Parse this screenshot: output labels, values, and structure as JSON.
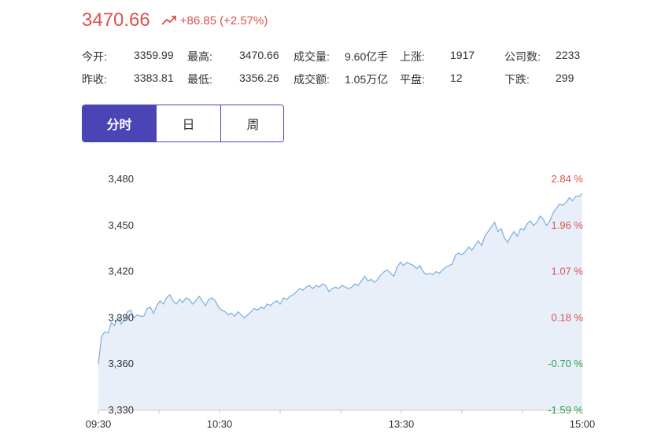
{
  "quote": {
    "price": "3470.66",
    "change": "+86.85",
    "change_pct": "(+2.57%)",
    "up_color": "#d9534f",
    "down_color": "#2e9e4f",
    "trend_icon": "trend-up-icon"
  },
  "stats": {
    "row1": [
      {
        "label": "今开:",
        "value": "3359.99"
      },
      {
        "label": "最高:",
        "value": "3470.66"
      },
      {
        "label": "成交量:",
        "value": "9.60亿手"
      },
      {
        "label": "上涨:",
        "value": "1917"
      },
      {
        "label": "公司数:",
        "value": "2233"
      }
    ],
    "row2": [
      {
        "label": "昨收:",
        "value": "3383.81"
      },
      {
        "label": "最低:",
        "value": "3356.26"
      },
      {
        "label": "成交额:",
        "value": "1.05万亿"
      },
      {
        "label": "平盘:",
        "value": "12"
      },
      {
        "label": "下跌:",
        "value": "299"
      }
    ]
  },
  "tabs": [
    {
      "label": "分时",
      "active": true
    },
    {
      "label": "日",
      "active": false
    },
    {
      "label": "周",
      "active": false
    }
  ],
  "accent_color": "#4a44b4",
  "chart_data": {
    "type": "area",
    "title": "",
    "xlabel": "",
    "ylabel": "",
    "x_ticks": [
      "09:30",
      "10:30",
      "13:30",
      "15:00"
    ],
    "y_ticks": [
      3330,
      3360,
      3390,
      3420,
      3450,
      3480
    ],
    "y_tick_labels": [
      "3,330",
      "3,360",
      "3,390",
      "3,420",
      "3,450",
      "3,480"
    ],
    "pct_ticks": [
      "-1.59 %",
      "-0.70 %",
      "0.18 %",
      "1.07 %",
      "1.96 %",
      "2.84 %"
    ],
    "ylim": [
      3330,
      3480
    ],
    "grid": false,
    "line_color": "#7aaee0",
    "fill_color": "#e8eff9",
    "series": [
      {
        "values": [
          3360,
          3378,
          3381,
          3380,
          3387,
          3385,
          3391,
          3386,
          3389,
          3394,
          3395,
          3390,
          3392,
          3391,
          3391,
          3396,
          3397,
          3393,
          3398,
          3401,
          3399,
          3403,
          3405,
          3401,
          3399,
          3402,
          3400,
          3403,
          3402,
          3399,
          3401,
          3404,
          3401,
          3398,
          3402,
          3403,
          3401,
          3397,
          3395,
          3394,
          3392,
          3393,
          3391,
          3394,
          3392,
          3390,
          3392,
          3394,
          3396,
          3395,
          3397,
          3396,
          3399,
          3398,
          3400,
          3401,
          3399,
          3403,
          3402,
          3404,
          3405,
          3407,
          3409,
          3408,
          3410,
          3411,
          3409,
          3411,
          3410,
          3412,
          3411,
          3407,
          3409,
          3410,
          3409,
          3411,
          3410,
          3409,
          3410,
          3412,
          3411,
          3414,
          3417,
          3414,
          3415,
          3413,
          3415,
          3418,
          3420,
          3421,
          3419,
          3417,
          3423,
          3426,
          3424,
          3426,
          3425,
          3424,
          3422,
          3424,
          3420,
          3418,
          3419,
          3418,
          3420,
          3419,
          3421,
          3423,
          3424,
          3425,
          3431,
          3432,
          3431,
          3433,
          3436,
          3434,
          3437,
          3440,
          3437,
          3443,
          3446,
          3449,
          3452,
          3446,
          3448,
          3442,
          3439,
          3443,
          3446,
          3443,
          3448,
          3447,
          3451,
          3453,
          3450,
          3452,
          3456,
          3454,
          3450,
          3453,
          3458,
          3461,
          3464,
          3463,
          3465,
          3468,
          3466,
          3469,
          3469,
          3470.66
        ]
      }
    ]
  }
}
